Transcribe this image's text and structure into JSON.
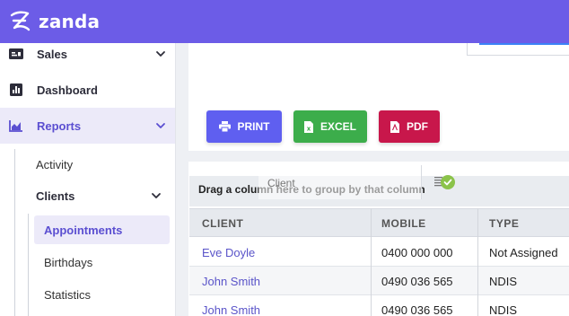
{
  "app": {
    "logo_text": "zanda"
  },
  "sidebar": {
    "items": [
      {
        "label": "Sales",
        "icon": "money-icon"
      },
      {
        "label": "Dashboard",
        "icon": "bar-chart-icon"
      },
      {
        "label": "Reports",
        "icon": "area-chart-icon"
      }
    ],
    "reports_sub": [
      {
        "label": "Activity"
      },
      {
        "label": "Clients"
      }
    ],
    "clients_sub": [
      {
        "label": "Appointments"
      },
      {
        "label": "Birthdays"
      },
      {
        "label": "Statistics"
      }
    ]
  },
  "toolbar": {
    "print_label": "PRINT",
    "excel_label": "EXCEL",
    "pdf_label": "PDF",
    "colors": {
      "print": "#5f5ff0",
      "excel": "#3cad4b",
      "pdf": "#c8174b"
    }
  },
  "grid": {
    "group_hint": "Drag a column here to group by that column",
    "dragging_column": "Client",
    "columns": [
      "CLIENT",
      "MOBILE",
      "TYPE"
    ],
    "rows": [
      {
        "client": "Eve Doyle",
        "mobile": "0400 000 000",
        "type": "Not Assigned"
      },
      {
        "client": "John Smith",
        "mobile": "0490 036 565",
        "type": "NDIS"
      },
      {
        "client": "John Smith",
        "mobile": "0490 036 565",
        "type": "NDIS"
      }
    ]
  },
  "theme": {
    "accent": "#6c5ce7",
    "link": "#5a54c9"
  }
}
